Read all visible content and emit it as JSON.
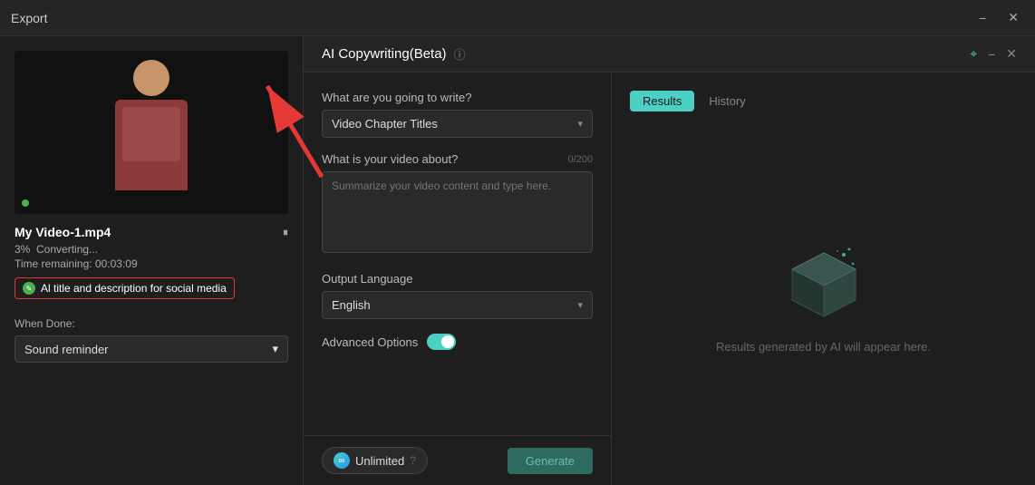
{
  "export_bar": {
    "title": "Export",
    "minimize_label": "−",
    "close_label": "✕"
  },
  "video_panel": {
    "filename": "My Video-1.mp4",
    "progress_percent": "3%",
    "progress_label": "Converting...",
    "time_remaining_label": "Time remaining: 00:03:09",
    "ai_badge_label": "Al title and description for social media",
    "when_done_label": "When Done:",
    "when_done_value": "Sound reminder",
    "pause_icon": "⏸"
  },
  "ai_panel": {
    "title": "AI Copywriting(Beta)",
    "help_icon": "?",
    "pin_icon": "📌",
    "minimize_icon": "−",
    "close_icon": "✕",
    "form": {
      "write_label": "What are you going to write?",
      "write_value": "Video Chapter Titles",
      "write_chevron": "▾",
      "about_label": "What is your video about?",
      "about_placeholder": "Summarize your video content and type here.",
      "char_count": "0/200",
      "output_lang_label": "Output Language",
      "output_lang_value": "English",
      "output_lang_chevron": "▾",
      "advanced_label": "Advanced Options",
      "toggle_state": "on"
    },
    "footer": {
      "unlimited_label": "Unlimited",
      "generate_label": "Generate"
    },
    "results": {
      "tab_results": "Results",
      "tab_history": "History",
      "empty_text": "Results generated by AI will appear here."
    }
  }
}
